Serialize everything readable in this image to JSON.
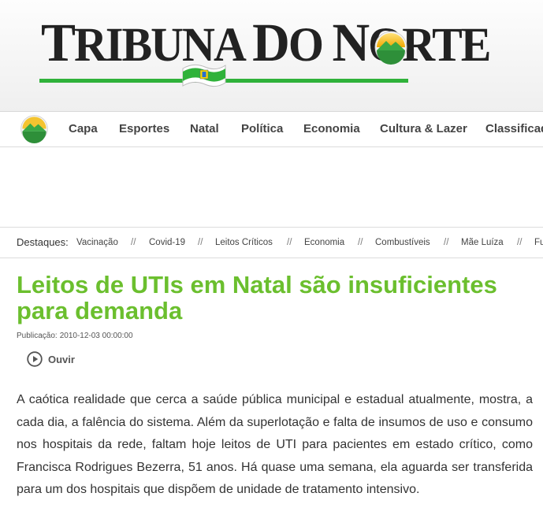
{
  "site": {
    "name_parts": [
      "T",
      "RIBUNA ",
      "D",
      "O ",
      "N",
      "ORTE"
    ],
    "brand_green": "#2fb23a"
  },
  "nav": {
    "items": [
      "Capa",
      "Esportes",
      "Natal",
      "Política",
      "Economia",
      "Cultura & Lazer",
      "Classificados"
    ]
  },
  "highlights": {
    "label": "Destaques:",
    "separator": "//",
    "items": [
      "Vacinação",
      "Covid-19",
      "Leitos Críticos",
      "Economia",
      "Combustíveis",
      "Mãe Luíza",
      "Fu"
    ]
  },
  "article": {
    "title": "Leitos de UTIs em Natal são insuficientes para demanda",
    "title_color": "#6bbf2e",
    "publication_label": "Publicação:",
    "publication_date": "2010-12-03 00:00:00",
    "listen_label": "Ouvir",
    "body": "A caótica realidade que cerca a saúde pública municipal e estadual atualmente, mostra, a cada dia, a falência do sistema. Além da superlotação e falta de insumos de uso e consumo nos hospitais da rede, faltam hoje leitos de UTI para pacientes em estado crítico, como Francisca Rodrigues Bezerra, 51 anos. Há quase uma semana, ela aguarda ser transferida para um dos hospitais que dispõem de unidade de tratamento intensivo."
  },
  "icons": {
    "logo_emblem": "mountain-sun-emblem-icon",
    "flag": "rio-grande-do-norte-flag-icon",
    "listen": "play-circle-icon"
  }
}
